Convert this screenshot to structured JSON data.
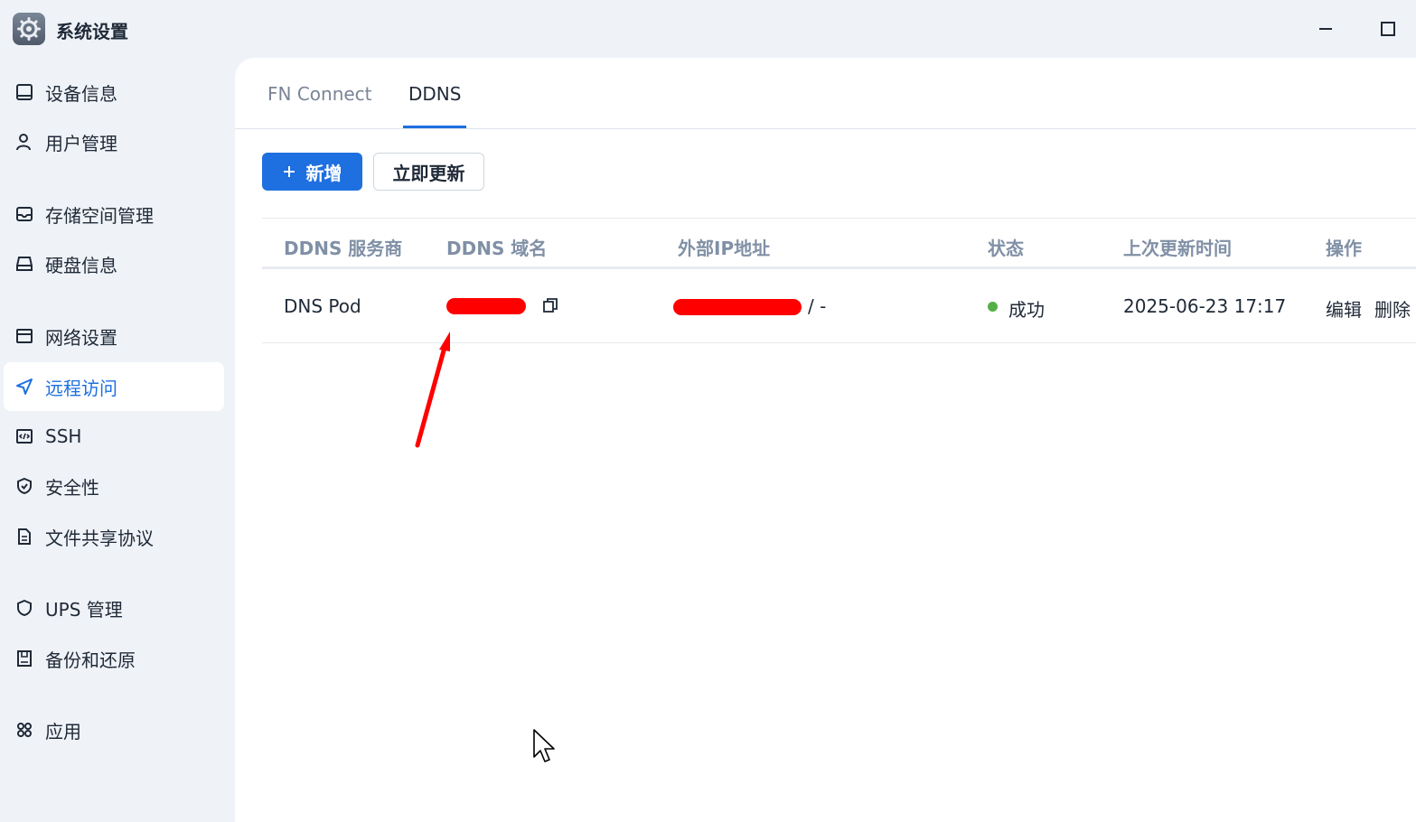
{
  "window": {
    "title": "系统设置",
    "icons": {
      "app": "gear-icon",
      "minimize": "minimize-icon",
      "maximize": "maximize-icon"
    }
  },
  "sidebar": {
    "items": [
      {
        "label": "设备信息",
        "icon": "device-icon",
        "active": false
      },
      {
        "label": "用户管理",
        "icon": "user-icon",
        "active": false
      },
      {
        "label": "存储空间管理",
        "icon": "storage-icon",
        "active": false
      },
      {
        "label": "硬盘信息",
        "icon": "disk-icon",
        "active": false
      },
      {
        "label": "网络设置",
        "icon": "network-icon",
        "active": false
      },
      {
        "label": "远程访问",
        "icon": "send-icon",
        "active": true
      },
      {
        "label": "SSH",
        "icon": "code-icon",
        "active": false
      },
      {
        "label": "安全性",
        "icon": "shield-check-icon",
        "active": false
      },
      {
        "label": "文件共享协议",
        "icon": "document-icon",
        "active": false
      },
      {
        "label": "UPS 管理",
        "icon": "shield-icon",
        "active": false
      },
      {
        "label": "备份和还原",
        "icon": "backup-icon",
        "active": false
      },
      {
        "label": "应用",
        "icon": "apps-icon",
        "active": false
      }
    ]
  },
  "tabs": [
    {
      "label": "FN Connect",
      "active": false
    },
    {
      "label": "DDNS",
      "active": true
    }
  ],
  "toolbar": {
    "add_label": "新增",
    "add_icon": "plus-icon",
    "update_label": "立即更新"
  },
  "table": {
    "columns": [
      "DDNS 服务商",
      "DDNS 域名",
      "外部IP地址",
      "状态",
      "上次更新时间",
      "操作"
    ],
    "rows": [
      {
        "provider": "DNS Pod",
        "domain_copy_icon": "copy-icon",
        "ip_suffix": "/ -",
        "status": "成功",
        "updated": "2025-06-23 17:17",
        "action_edit": "编辑",
        "action_delete": "删除"
      }
    ]
  },
  "colors": {
    "accent": "#1e6fe0",
    "success": "#52b045",
    "annotation": "#ff0000"
  }
}
